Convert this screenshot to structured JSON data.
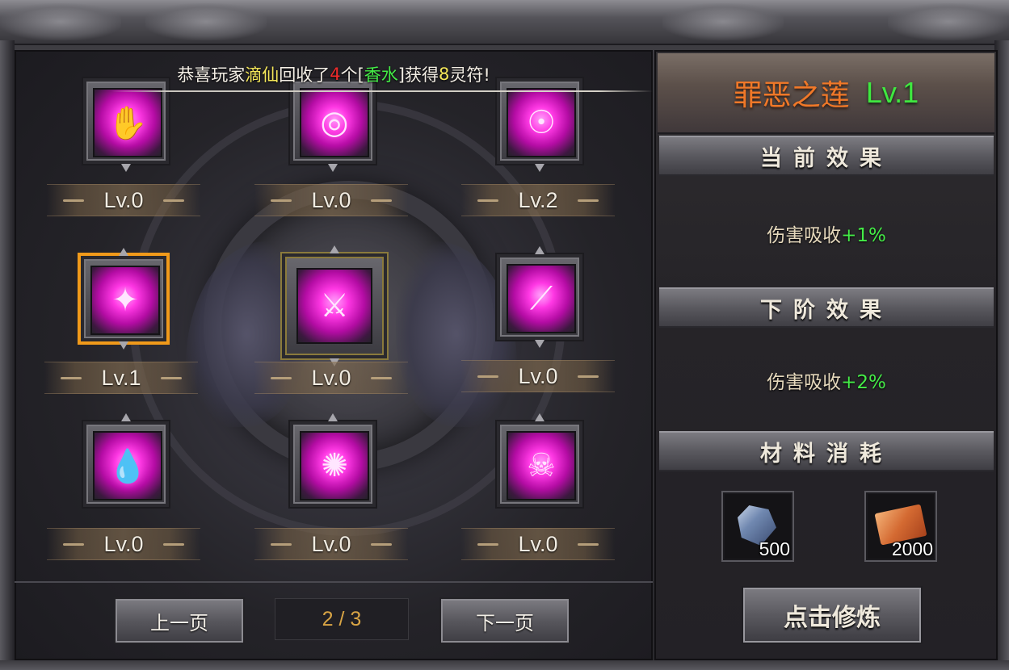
{
  "announcement": {
    "prefix": "恭喜玩家",
    "player": "滴仙",
    "mid1": "回收了",
    "count": "4",
    "mid2": "个[",
    "item": "香水",
    "mid3": "]获得",
    "reward": "8",
    "suffix": "灵符!"
  },
  "slots": [
    {
      "level": "Lv.0",
      "icon": "palm-rune-icon",
      "glyph": "✋"
    },
    {
      "level": "Lv.0",
      "icon": "vortex-blade-icon",
      "glyph": "◎"
    },
    {
      "level": "Lv.2",
      "icon": "demon-face-icon",
      "glyph": "☉"
    },
    {
      "level": "Lv.1",
      "icon": "lotus-flame-icon",
      "glyph": "✦",
      "selected": true
    },
    {
      "level": "Lv.0",
      "icon": "shadow-warrior-icon",
      "glyph": "⚔"
    },
    {
      "level": "Lv.0",
      "icon": "crimson-slash-icon",
      "glyph": "⟋"
    },
    {
      "level": "Lv.0",
      "icon": "spirit-drop-icon",
      "glyph": "💧"
    },
    {
      "level": "Lv.0",
      "icon": "lightning-orb-icon",
      "glyph": "✺"
    },
    {
      "level": "Lv.0",
      "icon": "flaming-skull-icon",
      "glyph": "☠"
    }
  ],
  "pagination": {
    "prev_label": "上一页",
    "indicator": "2 / 3",
    "next_label": "下一页"
  },
  "detail": {
    "name": "罪恶之莲",
    "level": "Lv.1",
    "current_header": "当前效果",
    "current_label": "伤害吸收",
    "current_value": "+1%",
    "next_header": "下阶效果",
    "next_label": "伤害吸收",
    "next_value": "+2%",
    "materials_header": "材料消耗",
    "materials": [
      {
        "icon": "blue-crystal-icon",
        "qty": "500"
      },
      {
        "icon": "talisman-scroll-icon",
        "qty": "2000"
      }
    ],
    "train_label": "点击修炼"
  },
  "colors": {
    "selected_outline": "#f19a1a",
    "announce_player": "#f4e75a",
    "announce_count": "#ee2b2b",
    "announce_item": "#44ec47",
    "title_name": "#f07828",
    "title_level": "#3fe840",
    "effect_value": "#44ec47"
  }
}
